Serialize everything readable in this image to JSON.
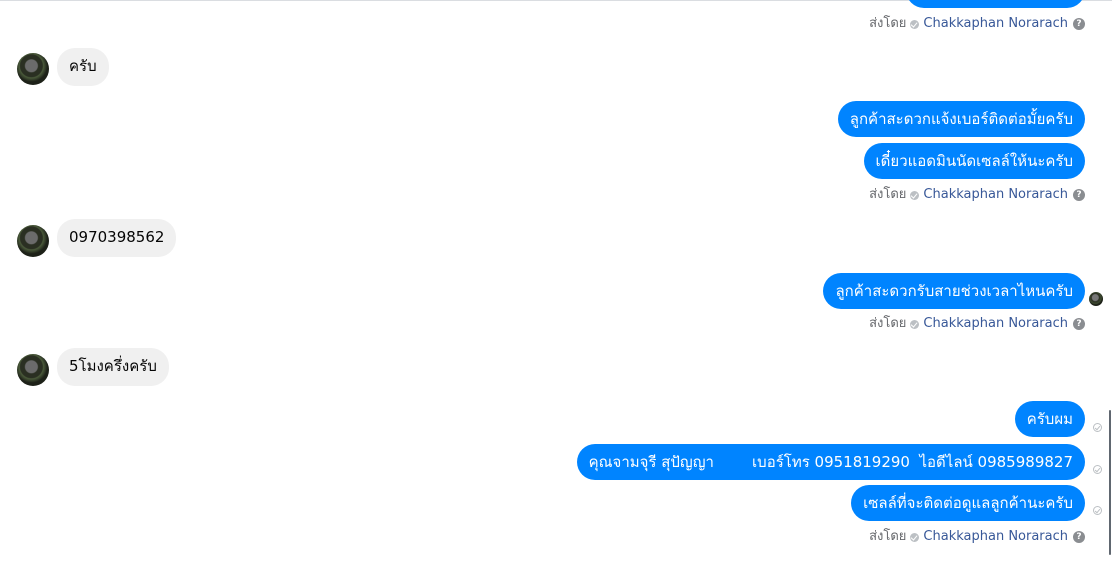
{
  "sender_label": "ส่งโดย",
  "agent_name": "Chakkaphan Norarach",
  "help_glyph": "?",
  "colors": {
    "outgoing_bubble": "#0084ff",
    "incoming_bubble": "#f0f0f0",
    "agent_link": "#385898",
    "meta_text": "#65676b"
  },
  "messages": {
    "in_1": "ครับ",
    "out_1": "ลูกค้าสะดวกแจ้งเบอร์ติดต่อมั้ยครับ",
    "out_2": "เดี๋ยวแอดมินนัดเซลล์ให้นะครับ",
    "in_2": "0970398562",
    "out_3": "ลูกค้าสะดวกรับสายช่วงเวลาไหนครับ",
    "in_3": "5โมงครึ่งครับ",
    "out_4": "ครับผม",
    "out_5": "คุณจามจุรี สุปัญญา        เบอร์โทร 0951819290  ไอดีไลน์ 0985989827",
    "out_6": "เซลล์ที่จะติดต่อดูแลลูกค้านะครับ"
  }
}
